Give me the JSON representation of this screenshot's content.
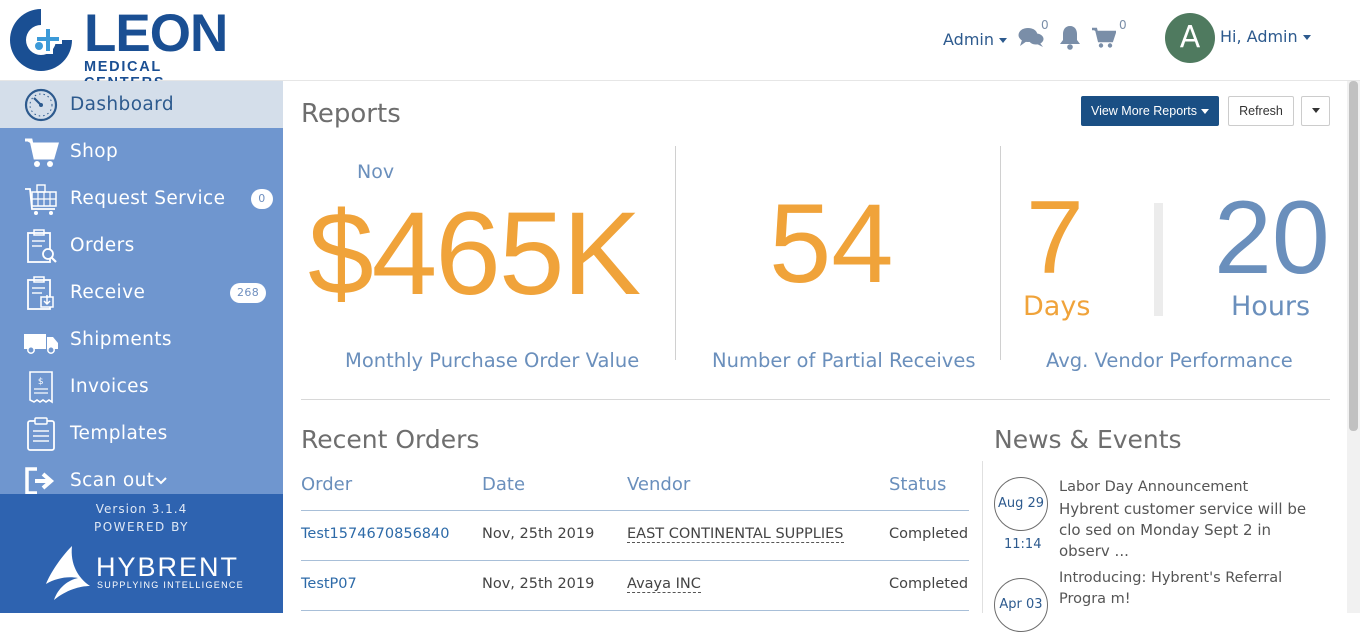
{
  "brand": {
    "name": "LEON",
    "subtitle": "MEDICAL CENTERS",
    "primary_color": "#1a4f93"
  },
  "header": {
    "admin_menu": "Admin",
    "chat_count": "0",
    "cart_count": "0",
    "avatar_letter": "A",
    "greeting": "Hi, Admin"
  },
  "sidebar": {
    "items": [
      {
        "label": "Dashboard",
        "icon": "dashboard-icon",
        "active": true
      },
      {
        "label": "Shop",
        "icon": "cart-icon"
      },
      {
        "label": "Request Service",
        "icon": "service-cart-icon",
        "badge": "0"
      },
      {
        "label": "Orders",
        "icon": "orders-clipboard-icon"
      },
      {
        "label": "Receive",
        "icon": "receive-clipboard-icon",
        "badge": "268"
      },
      {
        "label": "Shipments",
        "icon": "truck-icon"
      },
      {
        "label": "Invoices",
        "icon": "invoice-icon"
      },
      {
        "label": "Templates",
        "icon": "template-icon"
      },
      {
        "label": "Scan out",
        "icon": "scan-out-icon"
      }
    ],
    "version": "Version 3.1.4",
    "powered_by": "POWERED BY",
    "vendor_name": "HYBRENT",
    "vendor_tagline": "SUPPLYING INTELLIGENCE"
  },
  "reports": {
    "title": "Reports",
    "view_more": "View More Reports",
    "refresh": "Refresh",
    "month": "Nov",
    "po_value": "$465K",
    "po_label": "Monthly Purchase Order Value",
    "partial_receives": "54",
    "partial_label": "Number of Partial Receives",
    "vendor_days": "7",
    "days_unit": "Days",
    "vendor_hours": "20",
    "hours_unit": "Hours",
    "vendor_label": "Avg. Vendor Performance",
    "accent_color": "#f0a33a",
    "muted_blue": "#6a8fbc"
  },
  "recent_orders": {
    "title": "Recent Orders",
    "columns": [
      "Order",
      "Date",
      "Vendor",
      "Status"
    ],
    "rows": [
      {
        "order": "Test1574670856840",
        "date": "Nov, 25th 2019",
        "vendor": "EAST CONTINENTAL SUPPLIES",
        "status": "Completed"
      },
      {
        "order": "TestP07",
        "date": "Nov, 25th 2019",
        "vendor": "Avaya INC",
        "status": "Completed"
      }
    ]
  },
  "news": {
    "title": "News & Events",
    "items": [
      {
        "date": "Aug 29",
        "time": "11:14",
        "title": "Labor Day Announcement",
        "body": "Hybrent customer service will be clo sed on Monday Sept 2 in observ ..."
      },
      {
        "date": "Apr 03",
        "title": "Introducing: Hybrent's Referral Progra m!"
      }
    ]
  }
}
